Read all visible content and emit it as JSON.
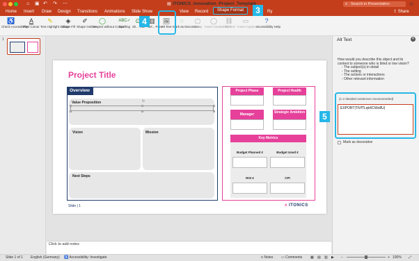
{
  "titlebar": {
    "title": "ITONICS_Innovation_Project_Template",
    "search_placeholder": "Search in Presentation",
    "colors": {
      "accent": "#c43e1c",
      "traffic": [
        "#ff5f57",
        "#febc2e",
        "#28c840"
      ]
    }
  },
  "tabs": [
    "Home",
    "Insert",
    "Draw",
    "Design",
    "Transitions",
    "Animations",
    "Slide Show",
    "View",
    "Record",
    "Shape Format",
    "Ry"
  ],
  "share_label": "Share",
  "ribbon": [
    {
      "label": "Check Accessibility",
      "icon": "accessibility-check-icon"
    },
    {
      "label": "Font Colour",
      "icon": "font-colour-icon"
    },
    {
      "label": "Text Highlight Colour",
      "icon": "highlight-icon"
    },
    {
      "label": "Shape Fill",
      "icon": "shape-fill-icon"
    },
    {
      "label": "Shape Outline",
      "icon": "shape-outline-icon"
    },
    {
      "label": "Inspect without Colour",
      "icon": "inspect-icon"
    },
    {
      "label": "Spelling",
      "icon": "spelling-icon"
    },
    {
      "label": "Sli... Title",
      "icon": "slide-title-icon"
    },
    {
      "label": "Sel... Pane",
      "icon": "selection-pane-icon"
    },
    {
      "label": "Alt Text",
      "icon": "alt-text-icon"
    },
    {
      "label": "Mark as Decorative",
      "icon": "mark-decorative-icon"
    },
    {
      "label": "Group",
      "icon": "group-icon"
    },
    {
      "label": "Insert Header Row",
      "icon": "header-row-icon"
    },
    {
      "label": "Link Text",
      "icon": "link-text-icon"
    },
    {
      "label": "Insert Captions",
      "icon": "captions-icon"
    },
    {
      "label": "Accessibility Help",
      "icon": "help-icon"
    }
  ],
  "badges": {
    "b3": "3",
    "b4": "4",
    "b5": "5",
    "color": "#25b7e8"
  },
  "thumbs": {
    "slide_num": "1"
  },
  "slide": {
    "title": "Project Title",
    "overview": "Overview",
    "value_proposition": "Value Proposition",
    "vision": "Vision",
    "mission": "Mission",
    "next_steps": "Next Steps",
    "project_phase": "Project Phase",
    "project_health": "Project Health",
    "manager": "Manager",
    "strategic_ambition": "Strategic Ambition",
    "key_metrics": "Key Metrics",
    "budget_planned": "Budget Planned €",
    "budget_used": "Budget Used €",
    "roi": "ROI €",
    "cpi": "CPI",
    "slide_num": "Slide | 1",
    "logo_mark": "ʌ",
    "logo": "ITONICS",
    "colors": {
      "pink": "#e6409a",
      "navy": "#1f3a6b"
    }
  },
  "notes_placeholder": "Click to add notes",
  "alt_pane": {
    "title": "Alt Text",
    "question": "How would you describe this object and its context to someone who is blind or low vision?",
    "bullets": [
      "- The subject(s) in detail",
      "- The setting",
      "- The actions or interactions",
      "- Other relevant information"
    ],
    "hint": "(1-2 detailed sentences recommended)",
    "value": "EXPORT|TtVfTLqtr6CWo8U|",
    "decorative_label": "Mark as decorative"
  },
  "status": {
    "slide": "Slide 1 of 1",
    "language": "English (Germany)",
    "accessibility": "Accessibility: Investigate",
    "notes": "Notes",
    "comments": "Comments",
    "zoom": "100%"
  }
}
